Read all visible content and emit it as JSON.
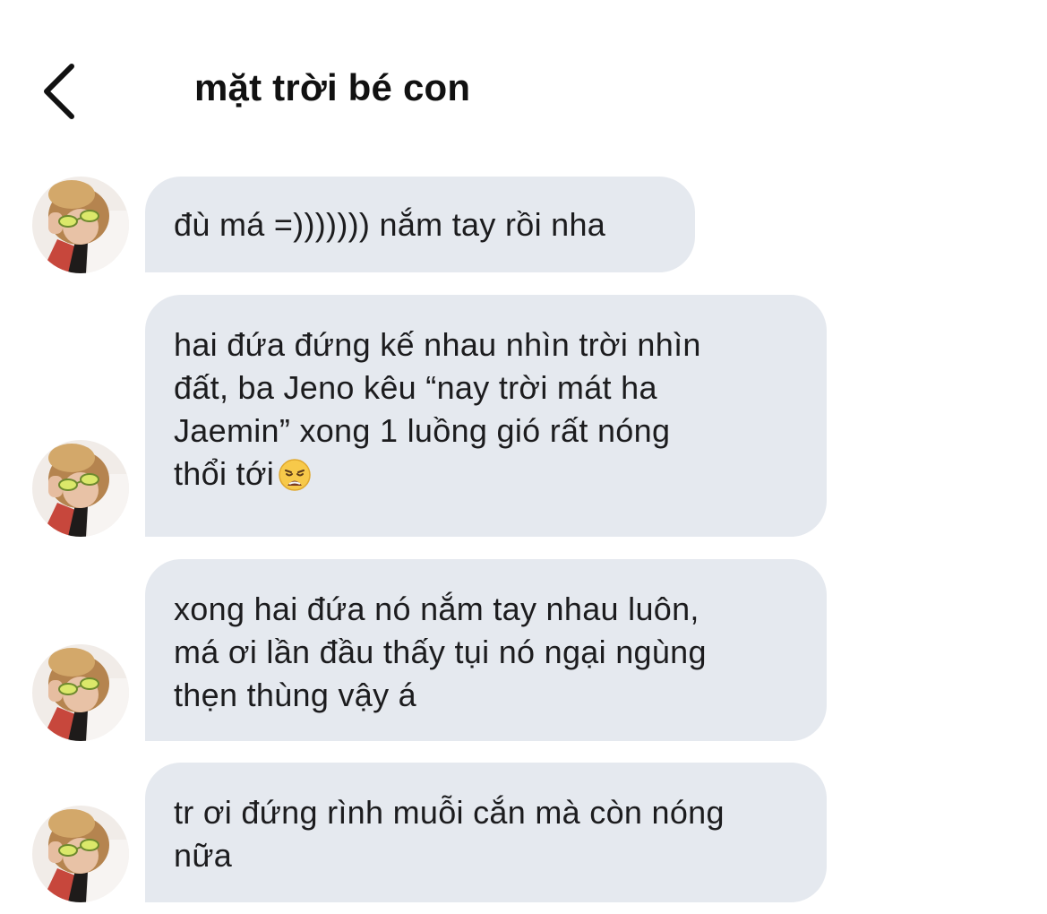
{
  "header": {
    "title": "mặt trời bé con"
  },
  "messages": [
    {
      "text": "đù má =))))))) nắm tay rồi nha"
    },
    {
      "text": "hai đứa đứng kế nhau nhìn trời nhìn\nđất, ba Jeno kêu “nay trời mát ha\nJaemin” xong 1 luồng gió rất nóng\nthổi tới",
      "emoji": "weary-face-emoji"
    },
    {
      "text": "xong hai đứa nó nắm tay nhau luôn,\nmá ơi lần đầu thấy tụi nó ngại ngùng\nthẹn thùng vậy á"
    },
    {
      "text": "tr ơi đứng rình muỗi cắn mà còn nóng\nnữa"
    }
  ],
  "colors": {
    "bubble": "#e5e9ef",
    "text": "#1c1c1e",
    "background": "#ffffff"
  }
}
